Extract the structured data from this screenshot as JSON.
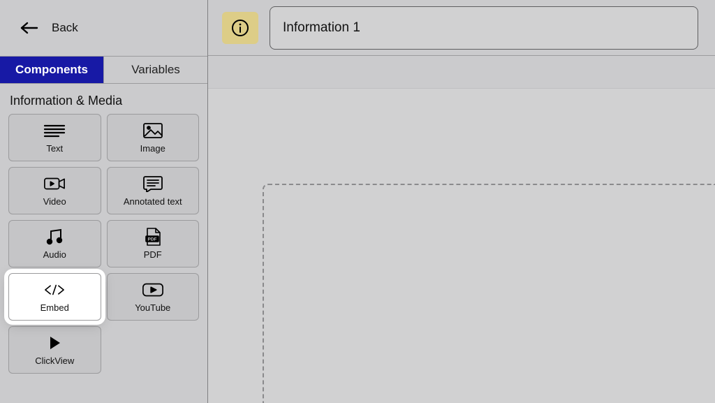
{
  "header": {
    "back_label": "Back",
    "title_value": "Information 1"
  },
  "tabs": {
    "components": "Components",
    "variables": "Variables"
  },
  "section": {
    "title": "Information & Media"
  },
  "tiles": {
    "text": "Text",
    "image": "Image",
    "video": "Video",
    "annotated": "Annotated text",
    "audio": "Audio",
    "pdf": "PDF",
    "embed": "Embed",
    "youtube": "YouTube",
    "clickview": "ClickView"
  }
}
